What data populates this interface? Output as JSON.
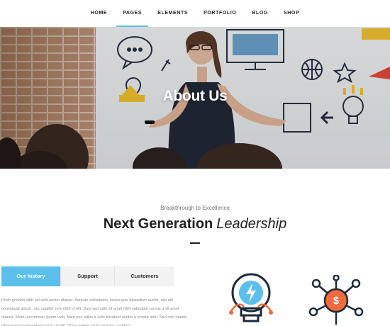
{
  "nav": {
    "items": [
      {
        "label": "HOME",
        "active": false
      },
      {
        "label": "PAGES",
        "active": true
      },
      {
        "label": "ELEMENTS",
        "active": false
      },
      {
        "label": "PORTFOLIO",
        "active": false
      },
      {
        "label": "BLOG",
        "active": false
      },
      {
        "label": "SHOP",
        "active": false
      }
    ]
  },
  "hero": {
    "title": "About Us"
  },
  "intro": {
    "eyebrow": "Breakthrough to Excellence",
    "headline_strong": "Next Generation",
    "headline_light": "Leadership"
  },
  "tabs": {
    "items": [
      "Our history",
      "Support",
      "Customers"
    ],
    "active_index": 0,
    "body": "Proin gravida nibh vel velit auctor aliquet. Aenean sollicitudin, lorem quis bibendum auctor, nisi elit consequat ipsum, nec sagittis sem nibh id elit. Duis sed odio sit amet nibh vulputate cursus a sit amet mauris. Morbi accumsan ipsum velit. Nam nec tellus a odio tincidunt auctor a ornare odio. Sed non  mauris vitae erat consequat auctor eu in elit. Class aptent taciti sociosqu ad litora"
  },
  "icons": {
    "first": "lightbulb-lightning-icon",
    "second": "dollar-network-icon"
  },
  "colors": {
    "accent": "#5bc0eb",
    "icon_orange": "#f26a3d",
    "icon_dark": "#1e2a3a"
  }
}
